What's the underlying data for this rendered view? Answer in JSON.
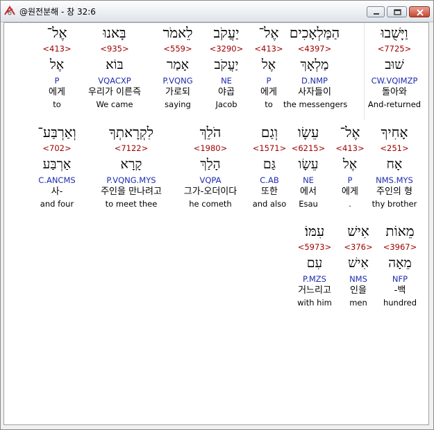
{
  "window": {
    "title": "@원전분해 - 창 32:6",
    "minimize_icon": "minimize-icon",
    "maximize_icon": "maximize-icon",
    "close_icon": "close-icon"
  },
  "words": [
    {
      "hebrew": "וַיָּשֻׁבוּ",
      "strong": "<7725>",
      "root": "שׁוּב",
      "morph": "CW.VQIMZP",
      "korean": "돌아와",
      "english": "And-returned"
    },
    {
      "hebrew": "הַמַּלְאָכִים",
      "strong": "<4397>",
      "root": "מַלְאָךְ",
      "morph": "D.NMP",
      "korean": "사자들이",
      "english": "the messengers"
    },
    {
      "hebrew": "אֶל־",
      "strong": "<413>",
      "root": "אֶל",
      "morph": "P",
      "korean": "에게",
      "english": "to"
    },
    {
      "hebrew": "יַעֲקֹב",
      "strong": "<3290>",
      "root": "יַעֲקֹב",
      "morph": "NE",
      "korean": "야곱",
      "english": "Jacob"
    },
    {
      "hebrew": "לֵאמֹר",
      "strong": "<559>",
      "root": "אָמַר",
      "morph": "P.VQNG",
      "korean": "가로되",
      "english": "saying"
    },
    {
      "hebrew": "בָּאנוּ",
      "strong": "<935>",
      "root": "בּוֹא",
      "morph": "VQACXP",
      "korean": "우리가 이른즉",
      "english": "We came"
    },
    {
      "hebrew": "אֶל־",
      "strong": "<413>",
      "root": "אֶל",
      "morph": "P",
      "korean": "에게",
      "english": "to"
    },
    {
      "hebrew": "אָחִיךָ",
      "strong": "<251>",
      "root": "אָח",
      "morph": "NMS.MYS",
      "korean": "주인의 형",
      "english": "thy brother"
    },
    {
      "hebrew": "אֶל־",
      "strong": "<413>",
      "root": "אֶל",
      "morph": "P",
      "korean": "에게",
      "english": "."
    },
    {
      "hebrew": "עֵשָׂו",
      "strong": "<6215>",
      "root": "עֵשָׂו",
      "morph": "NE",
      "korean": "에서",
      "english": "Esau"
    },
    {
      "hebrew": "וְגַם",
      "strong": "<1571>",
      "root": "גַּם",
      "morph": "C.AB",
      "korean": "또한",
      "english": "and also"
    },
    {
      "hebrew": "הֹלֵךְ",
      "strong": "<1980>",
      "root": "הָלַךְ",
      "morph": "VQPA",
      "korean": "그가-오더이다",
      "english": "he cometh"
    },
    {
      "hebrew": "לִקְרָאתְךָ",
      "strong": "<7122>",
      "root": "קָרָא",
      "morph": "P.VQNG.MYS",
      "korean": "주인을 만나려고",
      "english": "to meet thee"
    },
    {
      "hebrew": "וְאַרְבַּע־",
      "strong": "<702>",
      "root": "אַרְבַּע",
      "morph": "C.ANCMS",
      "korean": "사-",
      "english": "and four"
    },
    {
      "hebrew": "מֵאוֹת",
      "strong": "<3967>",
      "root": "מֵאָה",
      "morph": "NFP",
      "korean": "-백",
      "english": "hundred"
    },
    {
      "hebrew": "אִישׁ",
      "strong": "<376>",
      "root": "אִישׁ",
      "morph": "NMS",
      "korean": "인을",
      "english": "men"
    },
    {
      "hebrew": "עִמּוֹ׃",
      "strong": "<5973>",
      "root": "עִם",
      "morph": "P.MZS",
      "korean": "거느리고",
      "english": "with him"
    }
  ]
}
